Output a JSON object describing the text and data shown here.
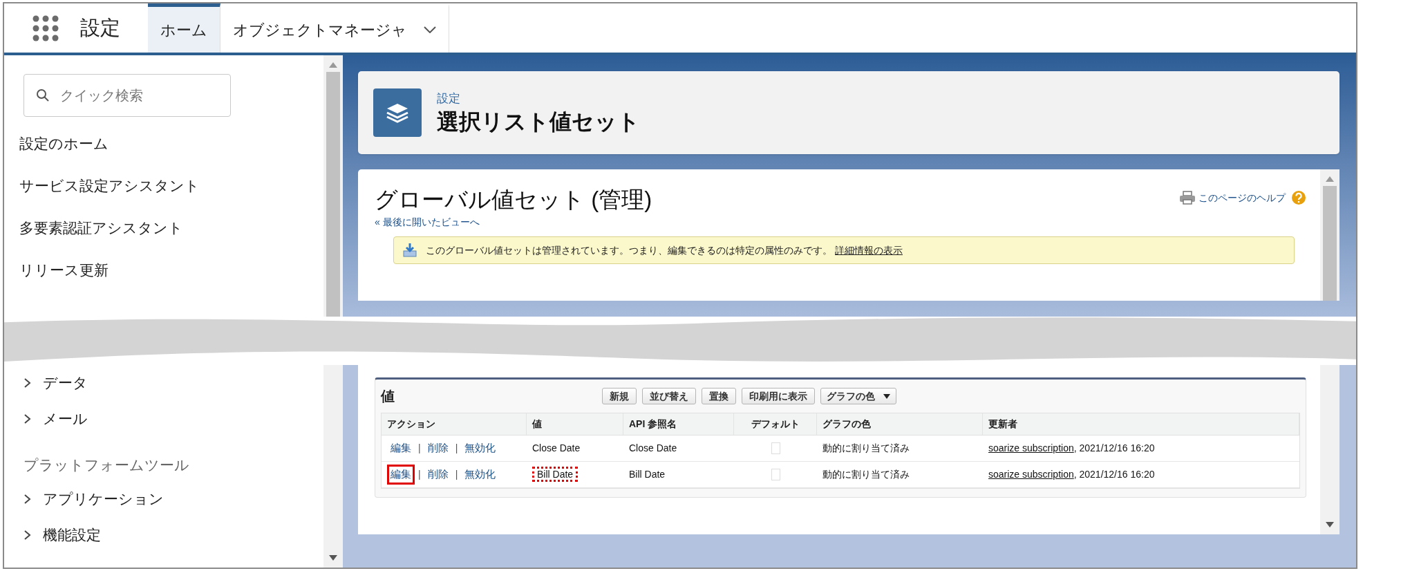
{
  "top_bar": {
    "app_title": "設定",
    "tabs": [
      {
        "label": "ホーム",
        "selected": true,
        "has_menu": false
      },
      {
        "label": "オブジェクトマネージャ",
        "selected": false,
        "has_menu": true
      }
    ]
  },
  "sidebar": {
    "search": {
      "placeholder": "クイック検索"
    },
    "items_top": [
      {
        "label": "設定のホーム",
        "kind": "link"
      },
      {
        "label": "サービス設定アシスタント",
        "kind": "link"
      },
      {
        "label": "多要素認証アシスタント",
        "kind": "link"
      },
      {
        "label": "リリース更新",
        "kind": "link"
      }
    ],
    "items_bottom": [
      {
        "label": "データ",
        "kind": "expandable",
        "expanded": false
      },
      {
        "label": "メール",
        "kind": "expandable",
        "expanded": false
      },
      {
        "label": "プラットフォームツール",
        "kind": "heading"
      },
      {
        "label": "アプリケーション",
        "kind": "expandable",
        "expanded": false
      },
      {
        "label": "機能設定",
        "kind": "expandable",
        "expanded": false
      }
    ]
  },
  "page_header": {
    "breadcrumb": "設定",
    "title": "選択リスト値セット"
  },
  "panel": {
    "title": "グローバル値セット (管理)",
    "back_link": "« 最後に開いたビューへ",
    "help_link": "このページのヘルプ",
    "notice": {
      "text": "このグローバル値セットは管理されています。つまり、編集できるのは特定の属性のみです。",
      "link": "詳細情報の表示"
    }
  },
  "values_section": {
    "title": "値",
    "buttons": [
      {
        "label": "新規",
        "kind": "button"
      },
      {
        "label": "並び替え",
        "kind": "button"
      },
      {
        "label": "置換",
        "kind": "button"
      },
      {
        "label": "印刷用に表示",
        "kind": "button"
      },
      {
        "label": "グラフの色",
        "kind": "dropdown"
      }
    ],
    "separator": "|",
    "table": {
      "columns": [
        "アクション",
        "値",
        "API 参照名",
        "デフォルト",
        "グラフの色",
        "更新者"
      ],
      "rows": [
        {
          "actions": [
            {
              "label": "編集",
              "marked": false
            },
            {
              "label": "削除",
              "marked": false
            },
            {
              "label": "無効化",
              "marked": false
            }
          ],
          "value": "Close Date",
          "value_marked": false,
          "api_name": "Close Date",
          "default": false,
          "chart_color": "動的に割り当て済み",
          "updated_by": "soarize subscription",
          "updated_at": ", 2021/12/16 16:20"
        },
        {
          "actions": [
            {
              "label": "編集",
              "marked": true
            },
            {
              "label": "削除",
              "marked": false
            },
            {
              "label": "無効化",
              "marked": false
            }
          ],
          "value": "Bill Date",
          "value_marked": true,
          "api_name": "Bill Date",
          "default": false,
          "chart_color": "動的に割り当て済み",
          "updated_by": "soarize subscription",
          "updated_at": ", 2021/12/16 16:20"
        }
      ]
    }
  }
}
